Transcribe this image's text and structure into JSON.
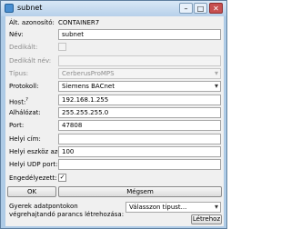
{
  "window": {
    "title": "subnet",
    "controls": {
      "minimize": "–",
      "maximize": "□",
      "close": "✕"
    },
    "colors": {
      "titlebar": "#b7d0ea",
      "close": "#c75050"
    }
  },
  "form": {
    "alt_azonosito": {
      "label": "Ált. azonosító:",
      "value": "CONTAINER7"
    },
    "nev": {
      "label": "Név:",
      "value": "subnet"
    },
    "dedikalt": {
      "label": "Dedikált:",
      "checked": false
    },
    "dedikalt_nev": {
      "label": "Dedikált név:",
      "value": ""
    },
    "tipus": {
      "label": "Típus:",
      "value": "CerberusProMPS"
    },
    "protokoll": {
      "label": "Protokoll:",
      "value": "Siemens BACnet"
    },
    "host": {
      "label": "Host:",
      "help": "?",
      "value": "192.168.1.255"
    },
    "alhalozat": {
      "label": "Alhálózat:",
      "value": "255.255.255.0"
    },
    "port": {
      "label": "Port:",
      "value": "47808"
    },
    "helyi_cim": {
      "label": "Helyi cím:",
      "value": ""
    },
    "helyi_eszkoz_azonosito": {
      "label": "Helyi eszköz azonosító:",
      "value": "100"
    },
    "helyi_udp_port": {
      "label": "Helyi UDP port:",
      "value": ""
    },
    "engedelyezett": {
      "label": "Engedélyezett:",
      "checked": true,
      "mark": "✓"
    }
  },
  "buttons": {
    "ok": "OK",
    "cancel": "Mégsem",
    "create": "Létrehoz"
  },
  "child_task": {
    "label_line1": "Gyerek adatpontokon",
    "label_line2": "végrehajtandó parancs létrehozása:",
    "select_value": "Válasszon típust..."
  }
}
